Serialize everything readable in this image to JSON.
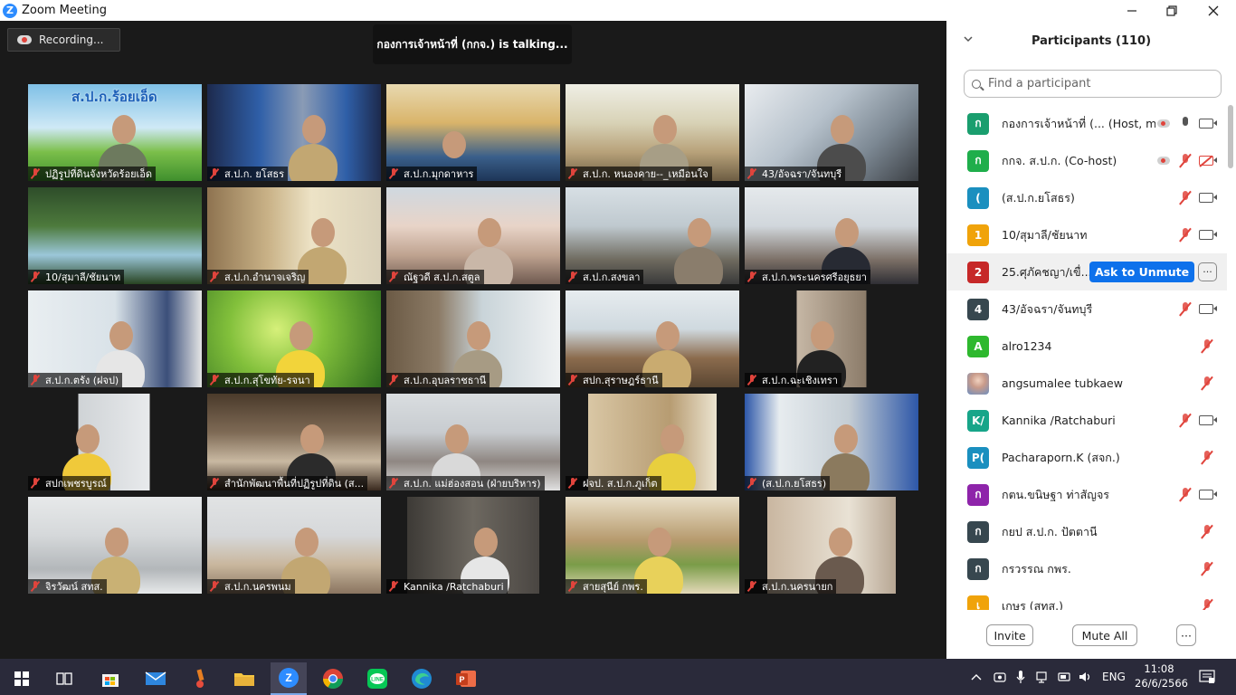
{
  "window": {
    "title": "Zoom Meeting"
  },
  "meeting": {
    "recording_label": "Recording...",
    "talking_banner": "กองการเจ้าหน้าที่ (กกจ.) is  talking...",
    "tiles": [
      "ปฏิรูปที่ดินจังหวัดร้อยเอ็ด",
      "ส.ป.ก. ยโสธร",
      "ส.ป.ก.มุกดาหาร",
      "ส.ป.ก. หนองคาย--_เหมือนใจ",
      "43/อัจฉรา/จันทบุรี",
      "10/สุมาลี/ชัยนาท",
      "ส.ป.ก.อำนาจเจริญ",
      "ณัฐวดี ส.ป.ก.สตูล",
      "ส.ป.ก.สงขลา",
      "ส.ป.ก.พระนครศรีอยุธยา",
      "ส.ป.ก.ตรัง (ฝจป)",
      "ส.ป.ก.สุโขทัย-รจนา",
      "ส.ป.ก.อุบลราชธานี",
      "สปก.สุราษฎร์ธานี",
      "ส.ป.ก.ฉะเชิงเทรา",
      "สปกเพชรบูรณ์",
      "สำนักพัฒนาพื้นที่ปฏิรูปที่ดิน (ส...",
      "ส.ป.ก. แม่ฮ่องสอน (ฝ่ายบริหาร)",
      "ฝจป. ส.ป.ก.ภูเก็ต",
      "(ส.ป.ก.ยโสธร)",
      "จิรวัฒน์ สทส.",
      "ส.ป.ก.นครพนม",
      "Kannika /Ratchaburi",
      "สายสุนีย์  กพร.",
      "ส.ป.ก.นครนายก"
    ],
    "tile_banner_text": "ส.ป.ก.ร้อยเอ็ด"
  },
  "participants": {
    "header": "Participants (110)",
    "search_placeholder": "Find a participant",
    "list": [
      {
        "initial": "ก",
        "color": "#1a9e6e",
        "name": "กองการเจ้าหน้าที่ (...  (Host, me)",
        "mic": "on",
        "cam": "on",
        "rec": true
      },
      {
        "initial": "ก",
        "color": "#1fae4b",
        "name": "กกจ. ส.ป.ก. (Co-host)",
        "mic": "off",
        "cam": "off",
        "rec": true
      },
      {
        "initial": "(",
        "color": "#1a8fbf",
        "name": "(ส.ป.ก.ยโสธร)",
        "mic": "off",
        "cam": "on",
        "rec": false
      },
      {
        "initial": "1",
        "color": "#f0a30a",
        "name": "10/สุมาลี/ชัยนาท",
        "mic": "off",
        "cam": "on",
        "rec": false
      },
      {
        "initial": "2",
        "color": "#c62828",
        "name": "25.ศุภัคชญา/เขื่...",
        "mic": "none",
        "cam": "none",
        "rec": false,
        "highlight": true
      },
      {
        "initial": "4",
        "color": "#37474f",
        "name": "43/อัจฉรา/จันทบุรี",
        "mic": "off",
        "cam": "on",
        "rec": false
      },
      {
        "initial": "A",
        "color": "#2eb82e",
        "name": "alro1234",
        "mic": "off",
        "cam": "none",
        "rec": false
      },
      {
        "initial": "",
        "color": "#b0a0d0",
        "name": "angsumalee tubkaew",
        "mic": "off",
        "cam": "none",
        "rec": false,
        "photo": true
      },
      {
        "initial": "K/",
        "color": "#17a589",
        "name": "Kannika /Ratchaburi",
        "mic": "off",
        "cam": "on",
        "rec": false
      },
      {
        "initial": "P(",
        "color": "#1a8fbf",
        "name": "Pacharaporn.K (สจก.)",
        "mic": "off",
        "cam": "none",
        "rec": false
      },
      {
        "initial": "ก",
        "color": "#8e24aa",
        "name": "กตน.ขนิษฐา ท่าสัญจร",
        "mic": "off",
        "cam": "on",
        "rec": false
      },
      {
        "initial": "ก",
        "color": "#37474f",
        "name": "กยป ส.ป.ก. ปัตตานี",
        "mic": "off",
        "cam": "none",
        "rec": false
      },
      {
        "initial": "ก",
        "color": "#37474f",
        "name": "กรวรรณ กพร.",
        "mic": "off",
        "cam": "none",
        "rec": false
      },
      {
        "initial": "เ",
        "color": "#f0a30a",
        "name": "เกษร (สทส.)",
        "mic": "off",
        "cam": "none",
        "rec": false
      }
    ],
    "ask_unmute_label": "Ask to Unmute",
    "more_label": "···",
    "invite_label": "Invite",
    "mute_all_label": "Mute All",
    "footer_more_label": "···"
  },
  "taskbar": {
    "lang": "ENG",
    "time": "11:08",
    "date": "26/6/2566"
  }
}
